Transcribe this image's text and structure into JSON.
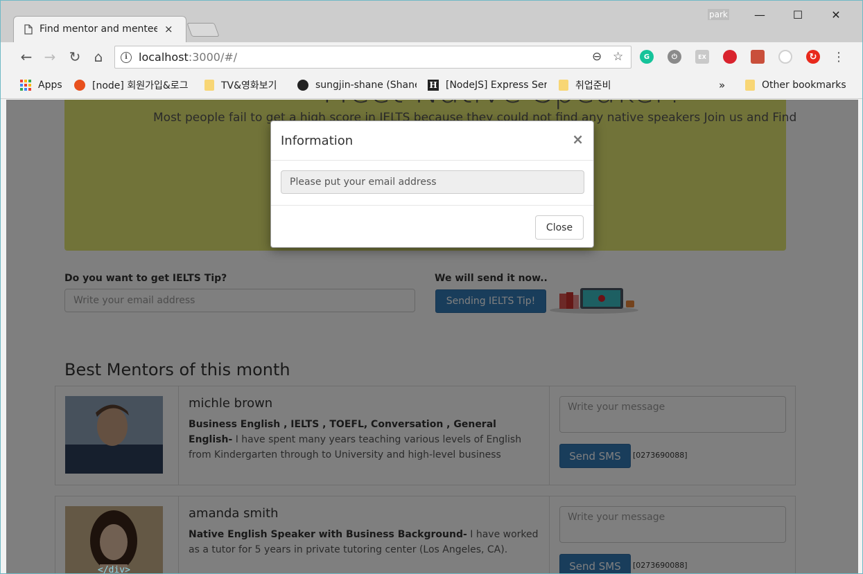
{
  "browser": {
    "tab_title": "Find mentor and mentee",
    "tab_close": "×",
    "user": "park",
    "url_host": "localhost",
    "url_path": ":3000/#/",
    "window_controls": {
      "minimize": "—",
      "maximize": "☐",
      "close": "✕"
    },
    "nav": {
      "back": "←",
      "forward": "→",
      "reload": "↻",
      "home": "⌂"
    },
    "omni_icons": {
      "zoom": "⊖",
      "star": "☆"
    },
    "menu": "⋮",
    "extensions": [
      {
        "name": "grammarly-icon",
        "label": "G",
        "color": "#15c39a"
      },
      {
        "name": "power-icon",
        "label": "⏻",
        "color": "#8a8a8a"
      },
      {
        "name": "ex-icon",
        "label": "EX",
        "color": "#c9c9c9"
      },
      {
        "name": "red-ball-icon",
        "label": "",
        "color": "#d9232d"
      },
      {
        "name": "bug-icon",
        "label": "",
        "color": "#c94f3b"
      },
      {
        "name": "target-icon",
        "label": "",
        "color": "#d0d0d0"
      },
      {
        "name": "sync-icon",
        "label": "↻",
        "color": "#e8291c"
      }
    ],
    "bookmarks": [
      {
        "label": "Apps"
      },
      {
        "label": "[node] 회원가입&로그"
      },
      {
        "label": "TV&영화보기"
      },
      {
        "label": "sungjin-shane (Shane"
      },
      {
        "label": "[NodeJS] Express Serv"
      },
      {
        "label": "취업준비"
      }
    ],
    "bookmarks_more": "»",
    "other_bookmarks": "Other bookmarks"
  },
  "page": {
    "hero_title": "Meet Native Speaker!",
    "hero_text": "Most people fail to get a high score in IELTS because they could not find any native speakers Join us and Find",
    "tip_label": "Do you want to get IELTS Tip?",
    "email_placeholder": "Write your email address",
    "send_label": "We will send it now..",
    "send_button": "Sending IELTS Tip!",
    "section_title": "Best Mentors of this month",
    "mentors": [
      {
        "name": "michle brown",
        "tags": "Business English , IELTS , TOEFL, Conversation , General English-",
        "desc": " I have spent many years teaching various levels of English from Kindergarten through to University and high-level business",
        "message_placeholder": "Write your message",
        "sms_button": "Send SMS",
        "phone": "[0273690088]"
      },
      {
        "name": "amanda smith",
        "tags": "Native English Speaker with Business Background-",
        "desc": " I have worked as a tutor for 5 years in private tutoring center (Los Angeles, CA).",
        "message_placeholder": "Write your message",
        "sms_button": "Send SMS",
        "phone": "[0273690088]"
      }
    ]
  },
  "modal": {
    "title": "Information",
    "close_x": "×",
    "message": "Please put your email address",
    "close_button": "Close"
  },
  "editor_peek": "</div>"
}
